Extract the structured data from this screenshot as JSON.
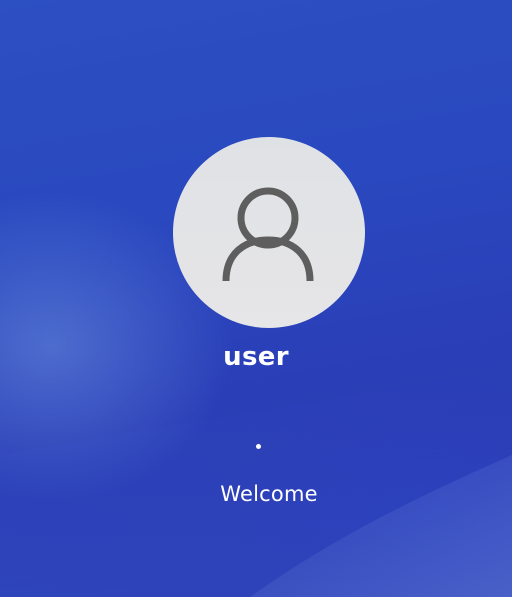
{
  "lock_screen": {
    "username": "user",
    "status_text": "Welcome",
    "avatar_icon": "user-silhouette-icon",
    "loading_indicator": "spinner-dot"
  },
  "colors": {
    "background": "#2a48bf",
    "avatar_bg": "#e3e4e6",
    "avatar_icon": "#5e5e5e",
    "text": "#ffffff"
  }
}
